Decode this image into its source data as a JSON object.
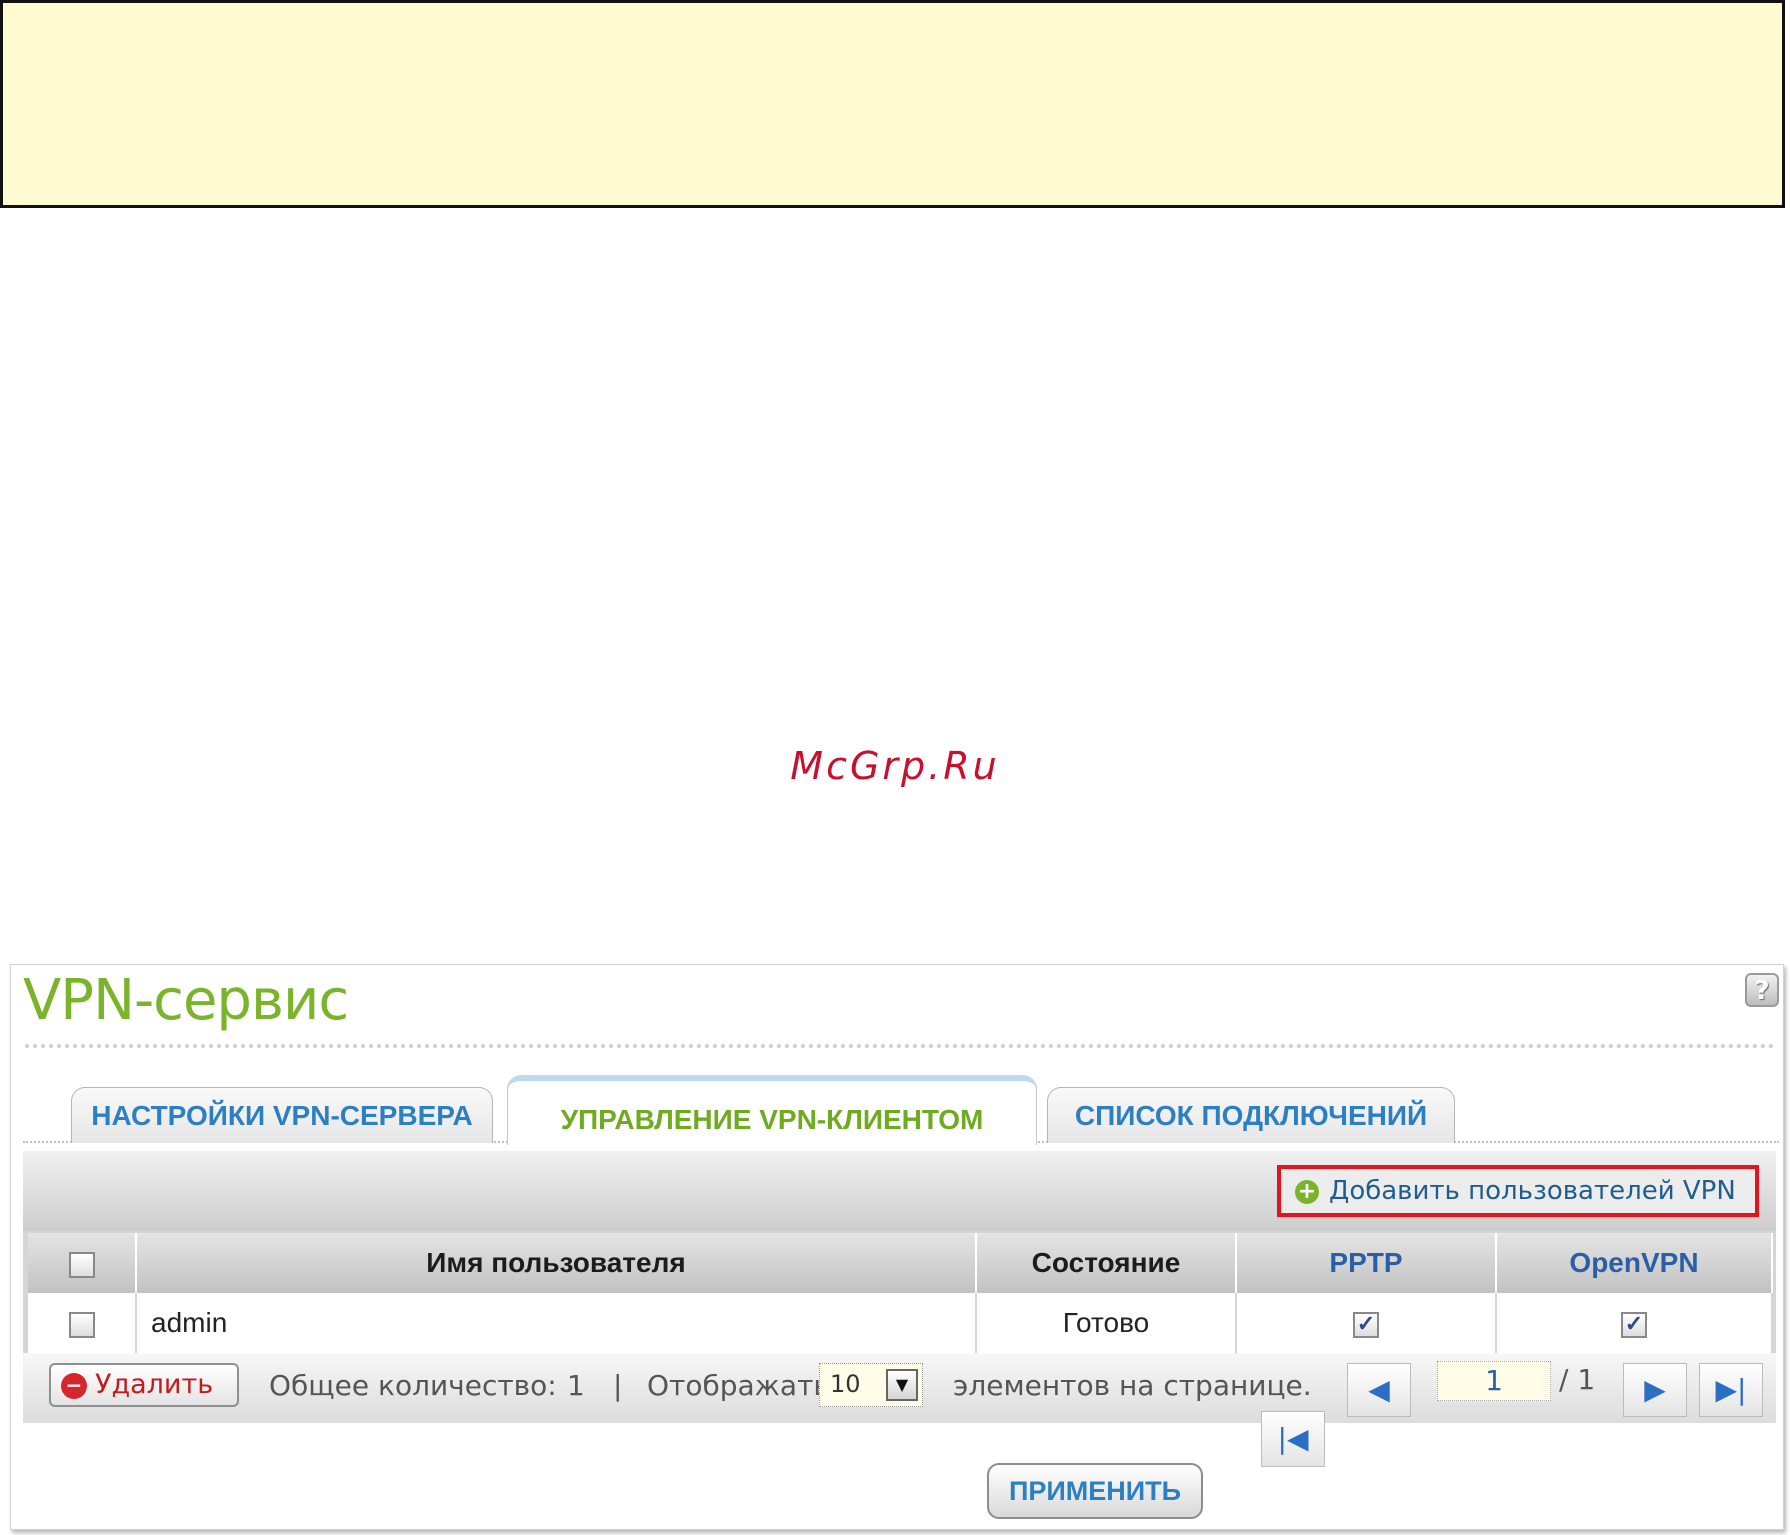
{
  "watermark": "McGrp.Ru",
  "page": {
    "title": "VPN-сервис",
    "help_icon": "?",
    "tabs": [
      {
        "label": "НАСТРОЙКИ VPN-СЕРВЕРА",
        "active": false
      },
      {
        "label": "УПРАВЛЕНИЕ VPN-КЛИЕНТОМ",
        "active": true
      },
      {
        "label": "СПИСОК ПОДКЛЮЧЕНИЙ",
        "active": false
      }
    ],
    "toolbar": {
      "add_label": "Добавить пользователей VPN",
      "add_icon": "plus-circle-icon"
    },
    "table": {
      "columns": [
        "Имя пользователя",
        "Состояние",
        "PPTP",
        "OpenVPN"
      ],
      "rows": [
        {
          "username": "admin",
          "status": "Готово",
          "pptp": true,
          "openvpn": true,
          "selected": false
        }
      ]
    },
    "footer": {
      "delete_label": "Удалить",
      "total_label": "Общее количество:",
      "total_count": "1",
      "separator": "|",
      "display_label": "Отображать",
      "rows_per_page": "10",
      "per_page_label": "элементов на странице.",
      "current_page": "1",
      "total_pages": "/ 1"
    },
    "apply_label": "ПРИМЕНИТЬ"
  },
  "colors": {
    "banner_bg": "#fffbd0",
    "title_green": "#7ab42a",
    "tab_blue": "#2b7fc2",
    "highlight_red": "#e3141d"
  }
}
